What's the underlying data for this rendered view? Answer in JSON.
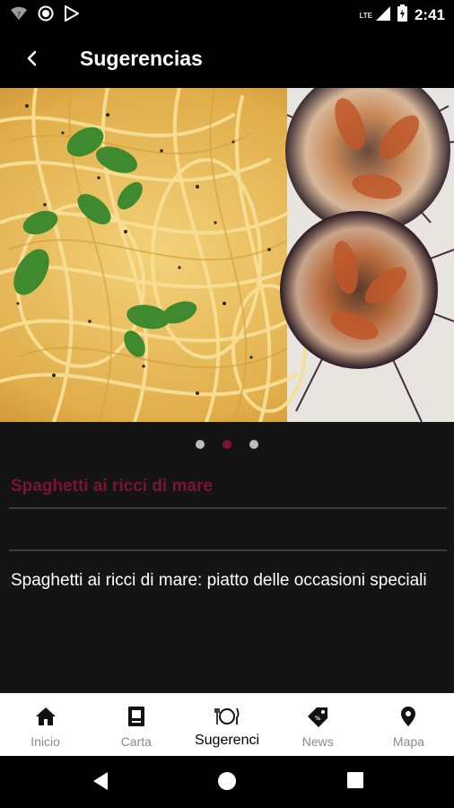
{
  "status_bar": {
    "time": "2:41",
    "network": "LTE",
    "icons": [
      "wifi-question-icon",
      "record-icon",
      "play-store-icon",
      "signal-icon",
      "battery-icon"
    ]
  },
  "app_bar": {
    "title": "Sugerencias",
    "back_icon": "back-arrow-icon"
  },
  "carousel": {
    "image": "spaghetti-sea-urchin-photo",
    "page_count": 3,
    "active_index": 1
  },
  "item": {
    "title": "Spaghetti ai ricci di mare",
    "description": "Spaghetti ai ricci di mare: piatto delle occasioni speciali"
  },
  "colors": {
    "accent": "#7a1431",
    "background": "#141414",
    "nav_background": "#ffffff"
  },
  "bottom_nav": {
    "items": [
      {
        "label": "Inicio",
        "icon": "home-icon"
      },
      {
        "label": "Carta",
        "icon": "menu-card-icon"
      },
      {
        "label": "Sugerenci",
        "icon": "plate-cutlery-icon"
      },
      {
        "label": "News",
        "icon": "tag-icon"
      },
      {
        "label": "Mapa",
        "icon": "map-pin-icon"
      }
    ],
    "active_index": 2
  },
  "system_nav": {
    "icons": [
      "back-triangle-icon",
      "home-circle-icon",
      "recents-square-icon"
    ]
  }
}
